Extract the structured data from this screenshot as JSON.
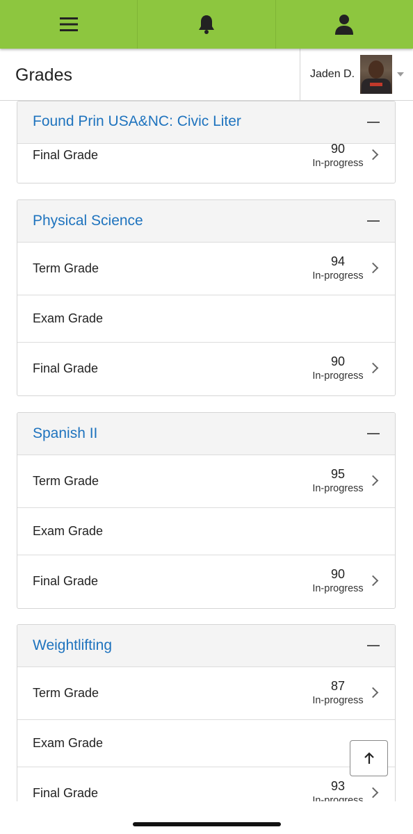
{
  "topbar": {
    "menu_icon": "hamburger-menu-icon",
    "notifications_icon": "bell-icon",
    "profile_icon": "person-icon",
    "accent_color": "#8dc63f"
  },
  "header": {
    "title": "Grades",
    "user_name": "Jaden D."
  },
  "courses": [
    {
      "name": "Found Prin USA&NC: Civic Liter",
      "rows": [
        {
          "label": "Final Grade",
          "grade": "90",
          "status": "In-progress",
          "has_detail": true
        }
      ]
    },
    {
      "name": "Physical Science",
      "rows": [
        {
          "label": "Term Grade",
          "grade": "94",
          "status": "In-progress",
          "has_detail": true
        },
        {
          "label": "Exam Grade",
          "grade": "",
          "status": "",
          "has_detail": false
        },
        {
          "label": "Final Grade",
          "grade": "90",
          "status": "In-progress",
          "has_detail": true
        }
      ]
    },
    {
      "name": "Spanish II",
      "rows": [
        {
          "label": "Term Grade",
          "grade": "95",
          "status": "In-progress",
          "has_detail": true
        },
        {
          "label": "Exam Grade",
          "grade": "",
          "status": "",
          "has_detail": false
        },
        {
          "label": "Final Grade",
          "grade": "90",
          "status": "In-progress",
          "has_detail": true
        }
      ]
    },
    {
      "name": "Weightlifting",
      "rows": [
        {
          "label": "Term Grade",
          "grade": "87",
          "status": "In-progress",
          "has_detail": true
        },
        {
          "label": "Exam Grade",
          "grade": "",
          "status": "",
          "has_detail": false
        },
        {
          "label": "Final Grade",
          "grade": "93",
          "status": "In-progress",
          "has_detail": true
        }
      ]
    }
  ],
  "scroll_top_icon": "arrow-up-icon",
  "link_color": "#1e73be"
}
